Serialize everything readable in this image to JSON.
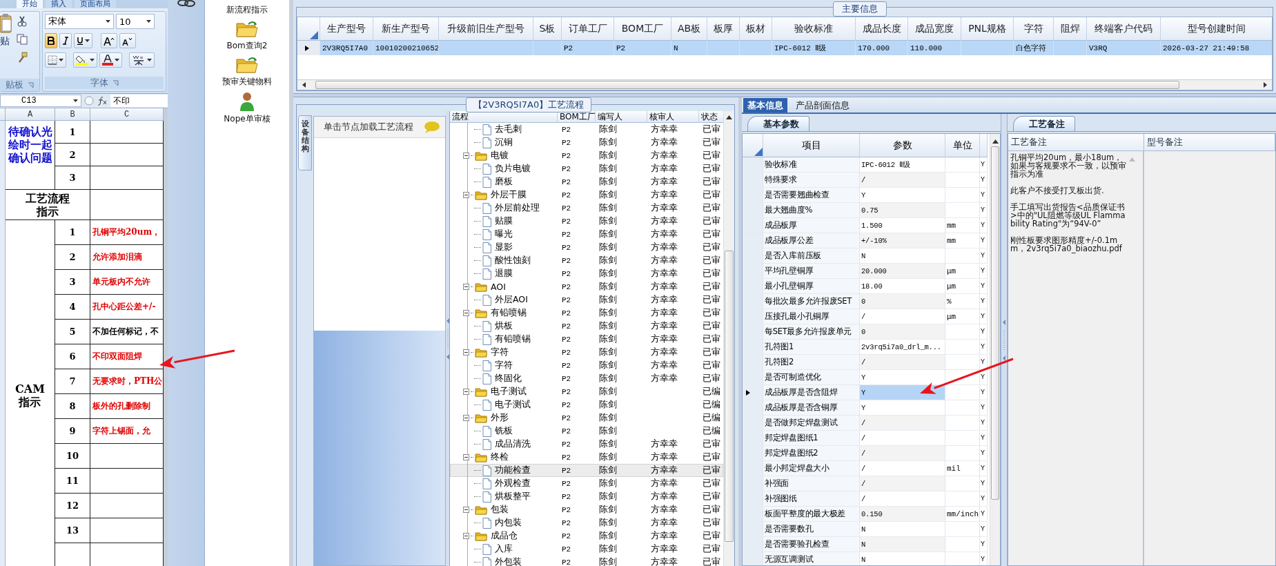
{
  "excel": {
    "ribbon_tabs": [
      {
        "label": "开始",
        "selected": true
      },
      {
        "label": "插入",
        "selected": false
      },
      {
        "label": "页面布局",
        "selected": false
      }
    ],
    "clipboard": {
      "paste_label": "贴",
      "group_label": "贴板"
    },
    "font_group": {
      "font_name": "宋体",
      "font_size": "10",
      "bold_active": true,
      "group_label": "字体"
    },
    "name_box": "C13",
    "formula": "不印",
    "columns": [
      "A",
      "B",
      "C"
    ],
    "sections": [
      {
        "kind": "confirm",
        "label": "待确认光绘时一起确认问题",
        "items": [
          {
            "no": "1"
          },
          {
            "no": "2"
          },
          {
            "no": "3"
          }
        ]
      },
      {
        "kind": "heading",
        "label": "工艺流程指示"
      },
      {
        "kind": "cam",
        "label": "CAM\n指示",
        "items": [
          {
            "no": "1",
            "text": "孔铜平均20um，",
            "color": "#e00000"
          },
          {
            "no": "2",
            "text": "允许添加泪滴",
            "color": "#e00000"
          },
          {
            "no": "3",
            "text": "单元板内不允许",
            "color": "#e00000"
          },
          {
            "no": "4",
            "text": "孔中心距公差+/-",
            "color": "#e00000"
          },
          {
            "no": "5",
            "text": "不加任何标记，不",
            "color": "#000000"
          },
          {
            "no": "6",
            "text": "不印双面阻焊",
            "color": "#e00000"
          },
          {
            "no": "7",
            "text": "无要求时，PTH公",
            "color": "#e00000"
          },
          {
            "no": "8",
            "text": "板外的孔删除制",
            "color": "#e00000"
          },
          {
            "no": "9",
            "text": "字符上锡面，允",
            "color": "#e00000"
          },
          {
            "no": "10"
          },
          {
            "no": "11"
          },
          {
            "no": "12"
          },
          {
            "no": "13"
          }
        ]
      }
    ]
  },
  "toolbar": {
    "items": [
      {
        "kind": "none",
        "label": "新流程指示"
      },
      {
        "kind": "folder",
        "label": "Bom查询2"
      },
      {
        "kind": "folder",
        "label": "预审关键物料"
      },
      {
        "kind": "person",
        "label": "Nope单审核"
      }
    ]
  },
  "main_info": {
    "legend": "主要信息",
    "row_selected": true,
    "columns": [
      {
        "header": "生产型号",
        "value": "2V3RQ5I7A0"
      },
      {
        "header": "新生产型号",
        "value": "10010200210652"
      },
      {
        "header": "升级前旧生产型号"
      },
      {
        "header": "S板"
      },
      {
        "header": "订单工厂",
        "value": "P2"
      },
      {
        "header": "BOM工厂",
        "value": "P2"
      },
      {
        "header": "AB板",
        "value": "N"
      },
      {
        "header": "板厚"
      },
      {
        "header": "板材"
      },
      {
        "header": "验收标准",
        "value": "IPC-6012 Ⅱ级"
      },
      {
        "header": "成品长度",
        "value": "170.000"
      },
      {
        "header": "成品宽度",
        "value": "110.000"
      },
      {
        "header": "PNL规格"
      },
      {
        "header": "字符",
        "value": "白色字符"
      },
      {
        "header": "阻焊"
      },
      {
        "header": "终端客户代码",
        "value": "V3RQ"
      },
      {
        "header": "型号创建时间",
        "value": "2026-03-27 21:49:58"
      }
    ]
  },
  "process": {
    "legend": "【2V3RQ5I7A0】工艺流程",
    "side_tab": "设备结构",
    "hint": "单击节点加载工艺流程",
    "columns": [
      "流程",
      "BOM工厂",
      "编写人",
      "核审人",
      "状态"
    ],
    "tree": [
      {
        "children": [
          {
            "name": "去毛刺",
            "factory": "P2",
            "writer": "陈剑",
            "reviewer": "方幸幸",
            "status": "已审",
            "selected": false
          },
          {
            "name": "沉铜",
            "factory": "P2",
            "writer": "陈剑",
            "reviewer": "方幸幸",
            "status": "已审",
            "selected": false
          }
        ]
      },
      {
        "name": "电镀",
        "factory": "P2",
        "writer": "陈剑",
        "reviewer": "方幸幸",
        "status": "已审",
        "selected": false,
        "expanded": true,
        "children": [
          {
            "name": "负片电镀",
            "factory": "P2",
            "writer": "陈剑",
            "reviewer": "方幸幸",
            "status": "已审",
            "selected": false
          },
          {
            "name": "磨板",
            "factory": "P2",
            "writer": "陈剑",
            "reviewer": "方幸幸",
            "status": "已审",
            "selected": false
          }
        ]
      },
      {
        "name": "外层干膜",
        "factory": "P2",
        "writer": "陈剑",
        "reviewer": "方幸幸",
        "status": "已审",
        "selected": false,
        "expanded": true,
        "children": [
          {
            "name": "外层前处理",
            "factory": "P2",
            "writer": "陈剑",
            "reviewer": "方幸幸",
            "status": "已审",
            "selected": false
          },
          {
            "name": "贴膜",
            "factory": "P2",
            "writer": "陈剑",
            "reviewer": "方幸幸",
            "status": "已审",
            "selected": false
          },
          {
            "name": "曝光",
            "factory": "P2",
            "writer": "陈剑",
            "reviewer": "方幸幸",
            "status": "已审",
            "selected": false
          },
          {
            "name": "显影",
            "factory": "P2",
            "writer": "陈剑",
            "reviewer": "方幸幸",
            "status": "已审",
            "selected": false
          },
          {
            "name": "酸性蚀刻",
            "factory": "P2",
            "writer": "陈剑",
            "reviewer": "方幸幸",
            "status": "已审",
            "selected": false
          },
          {
            "name": "退膜",
            "factory": "P2",
            "writer": "陈剑",
            "reviewer": "方幸幸",
            "status": "已审",
            "selected": false
          }
        ]
      },
      {
        "name": "AOI",
        "factory": "P2",
        "writer": "陈剑",
        "reviewer": "方幸幸",
        "status": "已审",
        "selected": false,
        "expanded": true,
        "children": [
          {
            "name": "外层AOI",
            "factory": "P2",
            "writer": "陈剑",
            "reviewer": "方幸幸",
            "status": "已审",
            "selected": false
          }
        ]
      },
      {
        "name": "有铅喷锡",
        "factory": "P2",
        "writer": "陈剑",
        "reviewer": "方幸幸",
        "status": "已审",
        "selected": false,
        "expanded": true,
        "children": [
          {
            "name": "烘板",
            "factory": "P2",
            "writer": "陈剑",
            "reviewer": "方幸幸",
            "status": "已审",
            "selected": false
          },
          {
            "name": "有铅喷锡",
            "factory": "P2",
            "writer": "陈剑",
            "reviewer": "方幸幸",
            "status": "已审",
            "selected": false
          }
        ]
      },
      {
        "name": "字符",
        "factory": "P2",
        "writer": "陈剑",
        "reviewer": "方幸幸",
        "status": "已审",
        "selected": false,
        "expanded": true,
        "children": [
          {
            "name": "字符",
            "factory": "P2",
            "writer": "陈剑",
            "reviewer": "方幸幸",
            "status": "已审",
            "selected": false
          },
          {
            "name": "终固化",
            "factory": "P2",
            "writer": "陈剑",
            "reviewer": "方幸幸",
            "status": "已审",
            "selected": false
          }
        ]
      },
      {
        "name": "电子测试",
        "factory": "P2",
        "writer": "陈剑",
        "status": "已编",
        "selected": false,
        "expanded": true,
        "children": [
          {
            "name": "电子测试",
            "factory": "P2",
            "writer": "陈剑",
            "status": "已编",
            "selected": false
          }
        ]
      },
      {
        "name": "外形",
        "factory": "P2",
        "writer": "陈剑",
        "status": "已编",
        "selected": false,
        "expanded": true,
        "children": [
          {
            "name": "铣板",
            "factory": "P2",
            "writer": "陈剑",
            "status": "已编",
            "selected": false
          },
          {
            "name": "成品清洗",
            "factory": "P2",
            "writer": "陈剑",
            "reviewer": "方幸幸",
            "status": "已审",
            "selected": false
          }
        ]
      },
      {
        "name": "终检",
        "factory": "P2",
        "writer": "陈剑",
        "reviewer": "方幸幸",
        "status": "已审",
        "selected": false,
        "expanded": true,
        "children": [
          {
            "name": "功能检查",
            "factory": "P2",
            "writer": "陈剑",
            "reviewer": "方幸幸",
            "status": "已审",
            "selected": true
          },
          {
            "name": "外观检查",
            "factory": "P2",
            "writer": "陈剑",
            "reviewer": "方幸幸",
            "status": "已审",
            "selected": false
          },
          {
            "name": "烘板整平",
            "factory": "P2",
            "writer": "陈剑",
            "reviewer": "方幸幸",
            "status": "已审",
            "selected": false
          }
        ]
      },
      {
        "name": "包装",
        "factory": "P2",
        "writer": "陈剑",
        "reviewer": "方幸幸",
        "status": "已审",
        "selected": false,
        "expanded": true,
        "children": [
          {
            "name": "内包装",
            "factory": "P2",
            "writer": "陈剑",
            "reviewer": "方幸幸",
            "status": "已审",
            "selected": false
          }
        ]
      },
      {
        "name": "成品仓",
        "factory": "P2",
        "writer": "陈剑",
        "reviewer": "方幸幸",
        "status": "已审",
        "selected": false,
        "expanded": true,
        "children": [
          {
            "name": "入库",
            "factory": "P2",
            "writer": "陈剑",
            "reviewer": "方幸幸",
            "status": "已审",
            "selected": false
          },
          {
            "name": "外包装",
            "factory": "P2",
            "writer": "陈剑",
            "reviewer": "方幸幸",
            "status": "已审",
            "selected": false
          }
        ]
      }
    ]
  },
  "params": {
    "tabs": [
      {
        "label": "基本信息",
        "selected": true
      },
      {
        "label": "产品剖面信息",
        "selected": false
      }
    ],
    "subtab": "基本参数",
    "columns": [
      "项目",
      "参数",
      "单位"
    ],
    "rows": [
      {
        "item": "验收标准",
        "value": "IPC-6012 Ⅱ级",
        "flag": "Y",
        "selected": false
      },
      {
        "item": "特殊要求",
        "value": "/",
        "flag": "Y",
        "selected": false
      },
      {
        "item": "是否需要翘曲检查",
        "value": "Y",
        "flag": "Y",
        "selected": false
      },
      {
        "item": "最大翘曲度%",
        "value": "0.75",
        "flag": "Y",
        "selected": false
      },
      {
        "item": "成品板厚",
        "value": "1.500",
        "unit": "mm",
        "flag": "Y",
        "selected": false
      },
      {
        "item": "成品板厚公差",
        "value": "+/-10%",
        "unit": "mm",
        "flag": "Y",
        "selected": false
      },
      {
        "item": "是否入库前压板",
        "value": "N",
        "flag": "Y",
        "selected": false
      },
      {
        "item": "平均孔壁铜厚",
        "value": "20.000",
        "unit": "μm",
        "flag": "Y",
        "selected": false
      },
      {
        "item": "最小孔壁铜厚",
        "value": "18.00",
        "unit": "μm",
        "flag": "Y",
        "selected": false
      },
      {
        "item": "每批次最多允许报废SET",
        "value": "0",
        "unit": "%",
        "flag": "Y",
        "selected": false
      },
      {
        "item": "压接孔最小孔铜厚",
        "value": "/",
        "unit": "μm",
        "flag": "Y",
        "selected": false
      },
      {
        "item": "每SET最多允许报废单元",
        "value": "0",
        "flag": "Y",
        "selected": false
      },
      {
        "item": "孔符图1",
        "value": "2v3rq5i7a0_drl_m...",
        "flag": "Y",
        "selected": false
      },
      {
        "item": "孔符图2",
        "value": "/",
        "flag": "Y",
        "selected": false
      },
      {
        "item": "是否可制造优化",
        "value": "Y",
        "flag": "Y",
        "selected": false
      },
      {
        "item": "成品板厚是否含阻焊",
        "value": "Y",
        "flag": "Y",
        "selected": true
      },
      {
        "item": "成品板厚是否含铜厚",
        "value": "Y",
        "flag": "Y",
        "selected": false
      },
      {
        "item": "是否做邦定焊盘测试",
        "value": "/",
        "flag": "Y",
        "selected": false
      },
      {
        "item": "邦定焊盘图纸1",
        "value": "/",
        "flag": "Y",
        "selected": false
      },
      {
        "item": "邦定焊盘图纸2",
        "value": "/",
        "flag": "Y",
        "selected": false
      },
      {
        "item": "最小邦定焊盘大小",
        "value": "/",
        "unit": "mil",
        "flag": "Y",
        "selected": false
      },
      {
        "item": "补强面",
        "value": "/",
        "flag": "Y",
        "selected": false
      },
      {
        "item": "补强图纸",
        "value": "/",
        "flag": "Y",
        "selected": false
      },
      {
        "item": "板面平整度的最大极差",
        "value": "0.150",
        "unit": "mm/inch",
        "flag": "Y",
        "selected": false
      },
      {
        "item": "是否需要数孔",
        "value": "N",
        "flag": "Y",
        "selected": false
      },
      {
        "item": "是否需要验孔检查",
        "value": "N",
        "flag": "Y",
        "selected": false
      },
      {
        "item": "无源互调测试",
        "value": "N",
        "flag": "Y",
        "selected": false
      }
    ]
  },
  "notes": {
    "tab": "工艺备注",
    "columns": [
      "工艺备注",
      "型号备注"
    ],
    "paragraphs": [
      "孔铜平均20um，最小18um，如果与客规要求不一致，以预审指示为准",
      "此客户不接受打叉板出货.",
      "手工填写出货报告<品质保证书>中的\"UL阻燃等级UL Flammability Rating\"为“94V-0”",
      "刚性板要求图形精度+/-0.1mm，2v3rq5i7a0_biaozhu.pdf"
    ]
  }
}
